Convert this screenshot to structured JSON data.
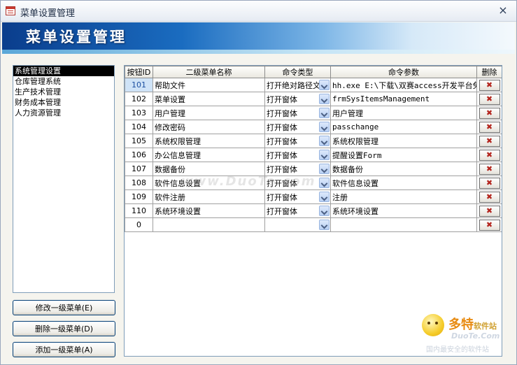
{
  "window": {
    "title": "菜单设置管理",
    "close_label": "×"
  },
  "banner": {
    "title": "菜单设置管理"
  },
  "menu_list": {
    "items": [
      "系统管理设置",
      "仓库管理系统",
      "生产技术管理",
      "财务成本管理",
      "人力资源管理"
    ],
    "selected_index": 0
  },
  "buttons": {
    "modify": "修改一级菜单(E)",
    "delete": "删除一级菜单(D)",
    "add": "添加一级菜单(A)"
  },
  "grid": {
    "columns": [
      "按钮ID",
      "二级菜单名称",
      "命令类型",
      "命令参数",
      "删除"
    ],
    "rows": [
      {
        "id": "101",
        "name": "帮助文件",
        "type": "打开绝对路径文",
        "param": "hh.exe E:\\下载\\双赛access开发平台免"
      },
      {
        "id": "102",
        "name": "菜单设置",
        "type": "打开窗体",
        "param": "frmSysItemsManagement"
      },
      {
        "id": "103",
        "name": "用户管理",
        "type": "打开窗体",
        "param": "用户管理"
      },
      {
        "id": "104",
        "name": "修改密码",
        "type": "打开窗体",
        "param": "passchange"
      },
      {
        "id": "105",
        "name": "系统权限管理",
        "type": "打开窗体",
        "param": "系统权限管理"
      },
      {
        "id": "106",
        "name": "办公信息管理",
        "type": "打开窗体",
        "param": "提醒设置Form"
      },
      {
        "id": "107",
        "name": "数据备份",
        "type": "打开窗体",
        "param": "数据备份"
      },
      {
        "id": "108",
        "name": "软件信息设置",
        "type": "打开窗体",
        "param": "软件信息设置"
      },
      {
        "id": "109",
        "name": "软件注册",
        "type": "打开窗体",
        "param": "注册"
      },
      {
        "id": "110",
        "name": "系统环境设置",
        "type": "打开窗体",
        "param": "系统环境设置"
      },
      {
        "id": "0",
        "name": "",
        "type": "",
        "param": ""
      }
    ]
  },
  "watermark": {
    "text": "www.DuoTe.com"
  },
  "logo": {
    "cn": "多特",
    "cn_small": "软件站",
    "en": "DuoTe.Com",
    "sub": "国内最安全的软件站"
  },
  "icons": {
    "app": "form-icon",
    "delete": "delete-x-icon",
    "dropdown": "chevron-down-icon"
  }
}
